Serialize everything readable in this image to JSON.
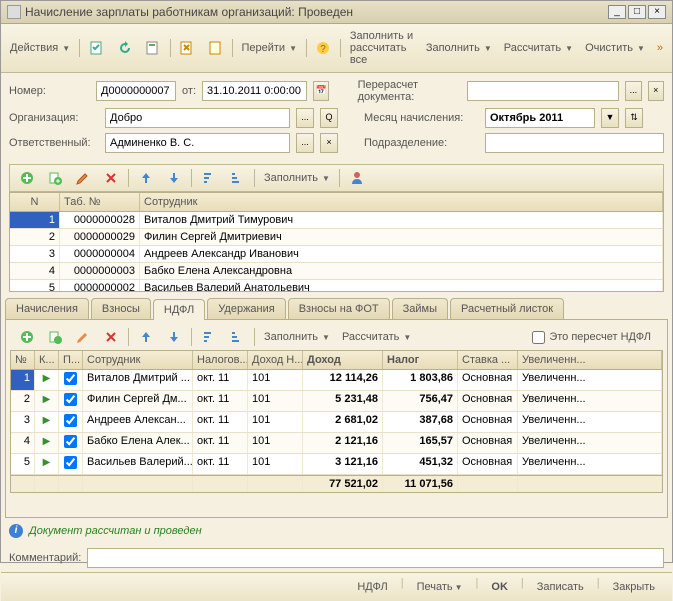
{
  "window": {
    "title": "Начисление зарплаты работникам организаций: Проведен"
  },
  "toolbar": {
    "actions": "Действия",
    "goto": "Перейти",
    "fill_calc_all": "Заполнить и рассчитать все",
    "fill": "Заполнить",
    "calc": "Рассчитать",
    "clear": "Очистить"
  },
  "form": {
    "number_label": "Номер:",
    "number_value": "Д0000000007",
    "ot_label": "от:",
    "date_value": "31.10.2011 0:00:00",
    "recalc_label": "Перерасчет документа:",
    "recalc_value": "",
    "org_label": "Организация:",
    "org_value": "Добро",
    "month_label": "Месяц начисления:",
    "month_value": "Октябрь 2011",
    "resp_label": "Ответственный:",
    "resp_value": "Админенко В. С.",
    "dept_label": "Подразделение:",
    "dept_value": ""
  },
  "sub_toolbar": {
    "fill": "Заполнить"
  },
  "employees": {
    "headers": {
      "n": "N",
      "tab": "Таб. №",
      "emp": "Сотрудник"
    },
    "rows": [
      {
        "n": "1",
        "tab": "0000000028",
        "emp": "Виталов Дмитрий Тимурович"
      },
      {
        "n": "2",
        "tab": "0000000029",
        "emp": "Филин Сергей Дмитриевич"
      },
      {
        "n": "3",
        "tab": "0000000004",
        "emp": "Андреев Александр Иванович"
      },
      {
        "n": "4",
        "tab": "0000000003",
        "emp": "Бабко Елена Александровна"
      },
      {
        "n": "5",
        "tab": "0000000002",
        "emp": "Васильев Валерий Анатольевич"
      }
    ]
  },
  "tabs": {
    "t1": "Начисления",
    "t2": "Взносы",
    "t3": "НДФЛ",
    "t4": "Удержания",
    "t5": "Взносы на ФОТ",
    "t6": "Займы",
    "t7": "Расчетный листок"
  },
  "ndfl_toolbar": {
    "fill": "Заполнить",
    "calc": "Рассчитать",
    "recalc_cb": "Это пересчет НДФЛ"
  },
  "ndfl": {
    "headers": {
      "n": "№",
      "k": "К...",
      "p": "П...",
      "emp": "Сотрудник",
      "period": "Налогов...",
      "code": "Доход Н...",
      "income": "Доход",
      "tax": "Налог",
      "rate": "Ставка ...",
      "inc": "Увеличенн..."
    },
    "rows": [
      {
        "n": "1",
        "emp": "Виталов Дмитрий ...",
        "period": "окт. 11",
        "code": "101",
        "income": "12 114,26",
        "tax": "1 803,86",
        "rate": "Основная",
        "inc": "Увеличенн..."
      },
      {
        "n": "2",
        "emp": "Филин Сергей Дм...",
        "period": "окт. 11",
        "code": "101",
        "income": "5 231,48",
        "tax": "756,47",
        "rate": "Основная",
        "inc": "Увеличенн..."
      },
      {
        "n": "3",
        "emp": "Андреев Алексан...",
        "period": "окт. 11",
        "code": "101",
        "income": "2 681,02",
        "tax": "387,68",
        "rate": "Основная",
        "inc": "Увеличенн..."
      },
      {
        "n": "4",
        "emp": "Бабко Елена Алек...",
        "period": "окт. 11",
        "code": "101",
        "income": "2 121,16",
        "tax": "165,57",
        "rate": "Основная",
        "inc": "Увеличенн..."
      },
      {
        "n": "5",
        "emp": "Васильев Валерий...",
        "period": "окт. 11",
        "code": "101",
        "income": "3 121,16",
        "tax": "451,32",
        "rate": "Основная",
        "inc": "Увеличенн..."
      }
    ],
    "totals": {
      "income": "77 521,02",
      "tax": "11 071,56"
    }
  },
  "status": {
    "text": "Документ рассчитан и проведен"
  },
  "comment": {
    "label": "Комментарий:",
    "value": ""
  },
  "bottom": {
    "ndfl": "НДФЛ",
    "print": "Печать",
    "ok": "OK",
    "save": "Записать",
    "close": "Закрыть"
  }
}
